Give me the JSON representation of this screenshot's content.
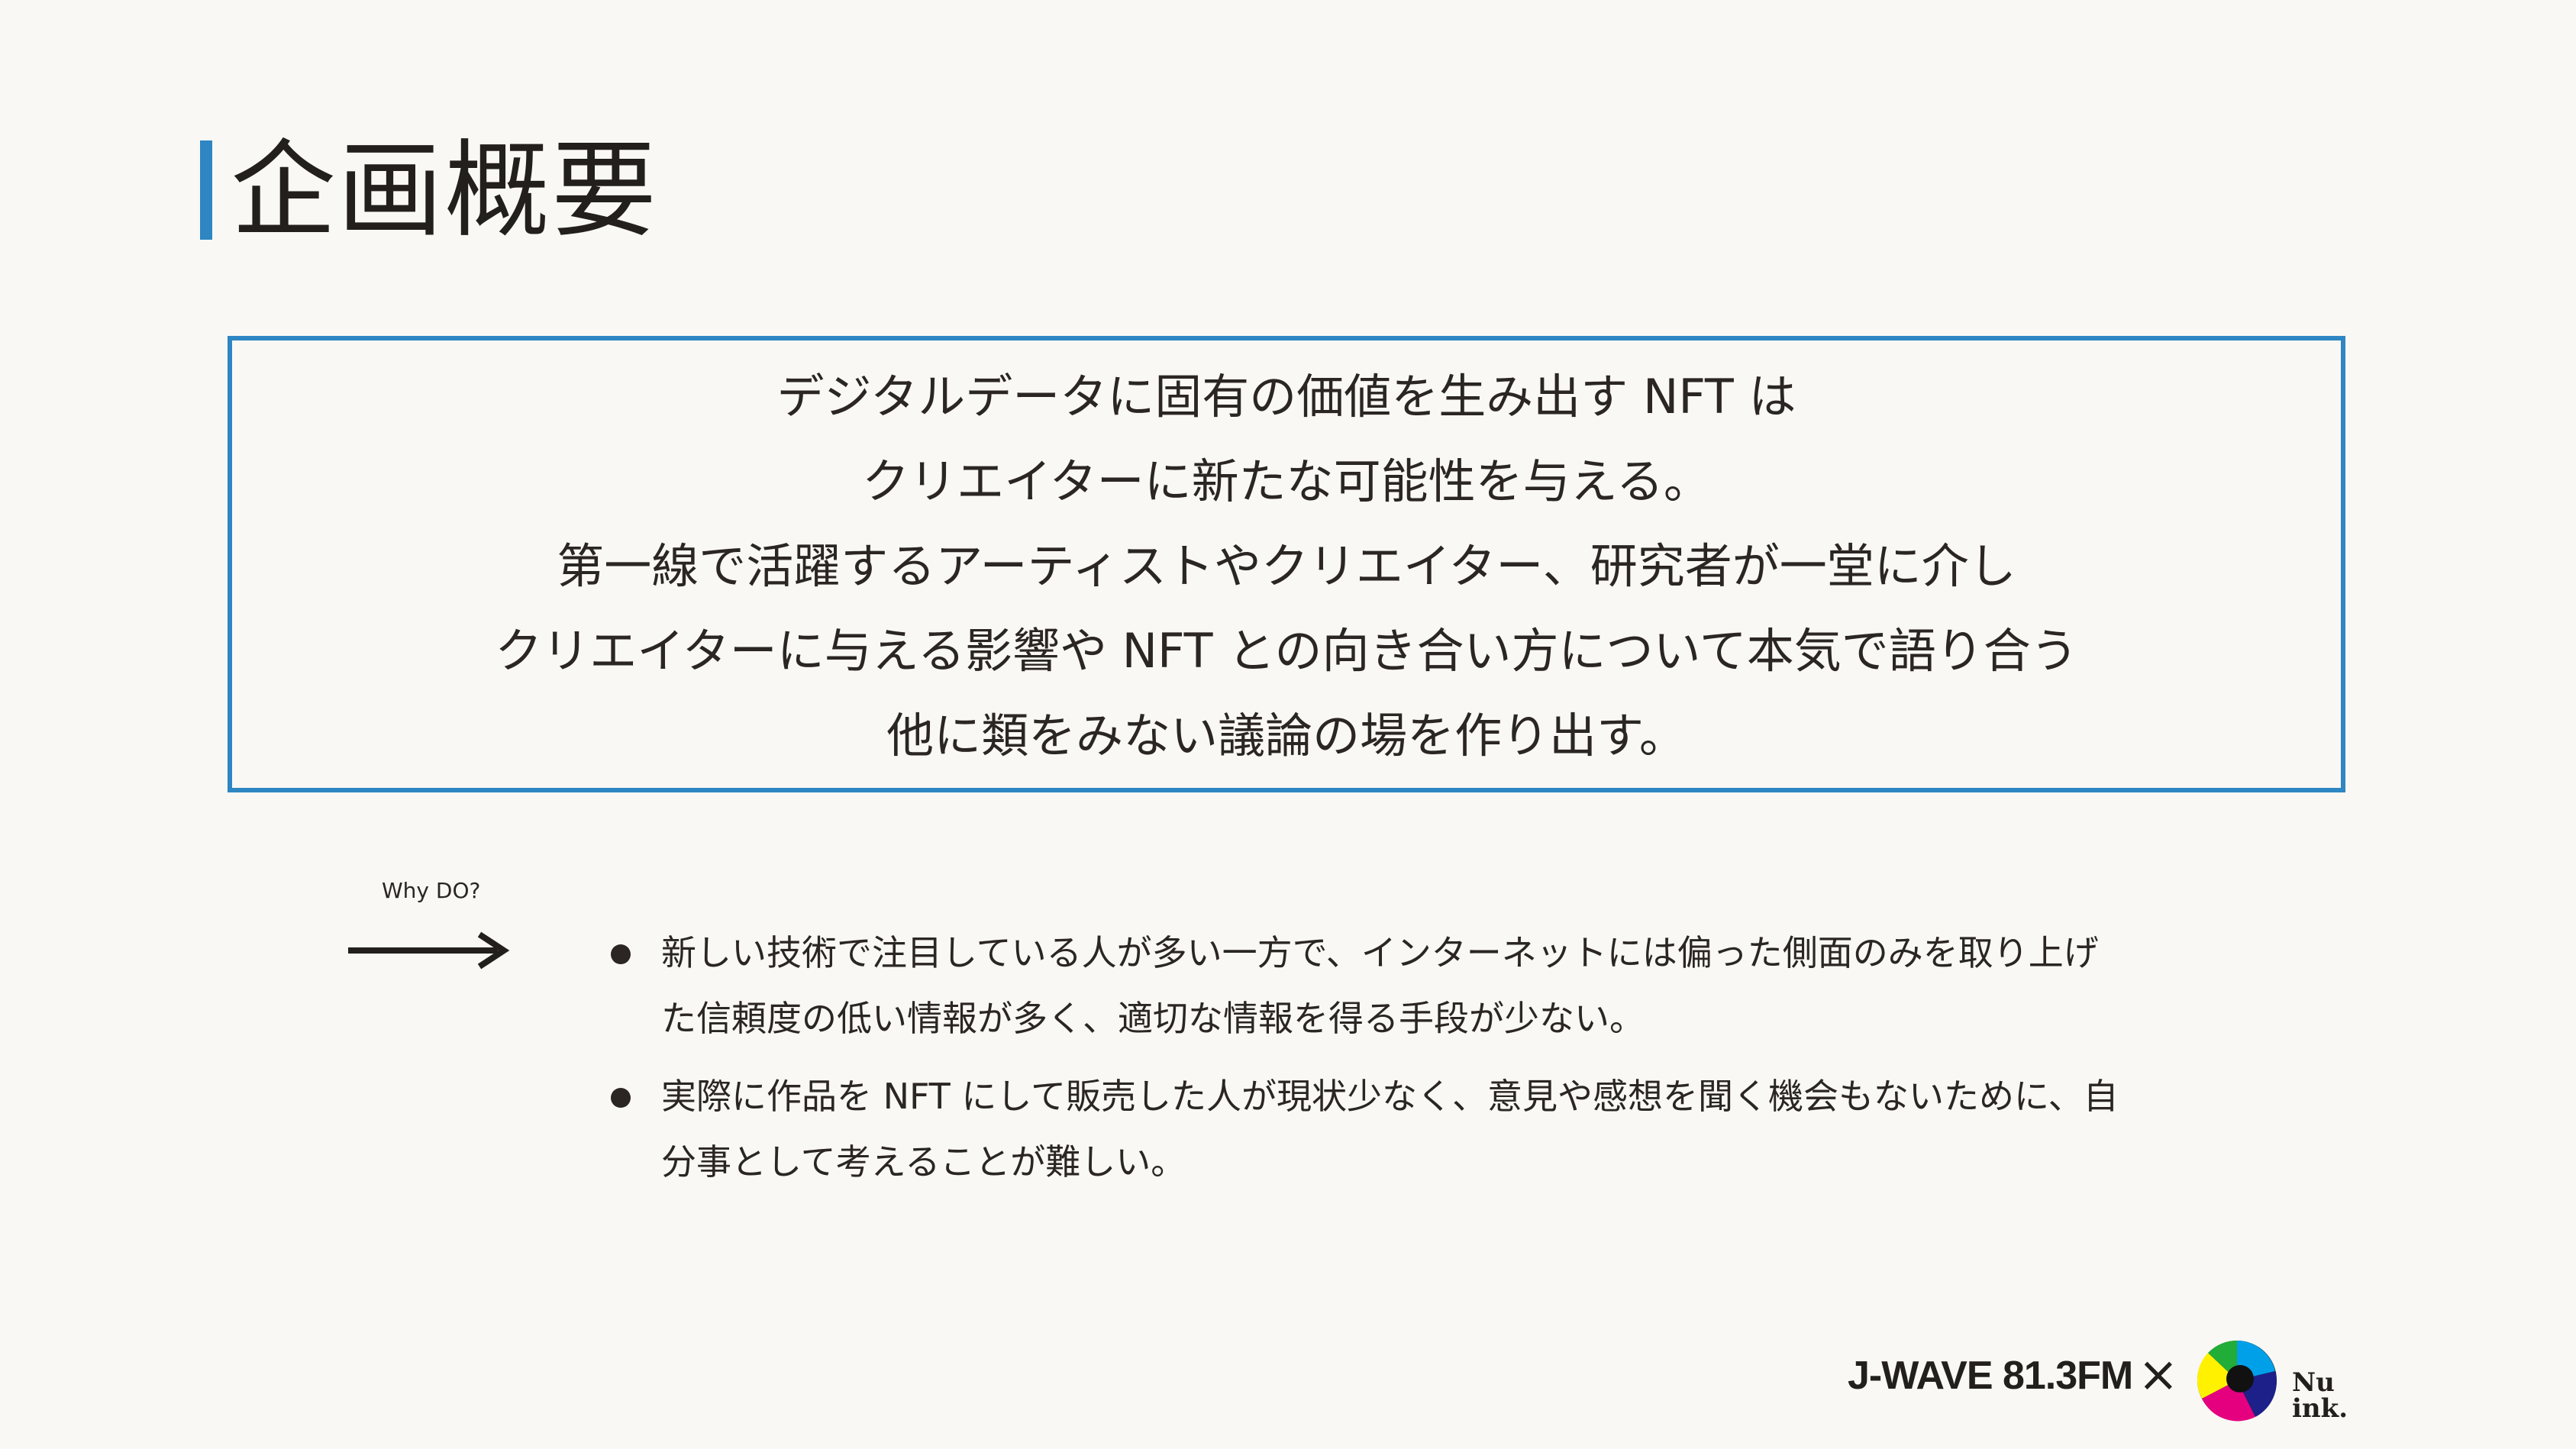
{
  "slide": {
    "title": "企画概要",
    "summary_lines": [
      "デジタルデータに固有の価値を生み出す NFT は",
      "クリエイターに新たな可能性を与える。",
      "第一線で活躍するアーティストやクリエイター、研究者が一堂に介し",
      "クリエイターに与える影響や NFT との向き合い方について本気で語り合う",
      "他に類をみない議論の場を作り出す。"
    ],
    "why_label": "Why DO?",
    "bullets": [
      {
        "line1": "新しい技術で注目している人が多い一方で、インターネットには偏った側面のみを取り上げ",
        "line2": "た信頼度の低い情報が多く、適切な情報を得る手段が少ない。"
      },
      {
        "line1": "実際に作品を NFT にして販売した人が現状少なく、意見や感想を聞く機会もないために、自",
        "line2": "分事として考えることが難しい。"
      }
    ]
  },
  "footer": {
    "jwave": "J-WAVE 81.3FM",
    "cross": "×",
    "nuink_name": "Nu\nink."
  },
  "colors": {
    "accent": "#2e86c3",
    "text": "#2b2623",
    "background": "#f9f8f5"
  },
  "icons": {
    "arrow": "long-right-arrow-icon",
    "logo": "nuink-color-logo-icon"
  }
}
